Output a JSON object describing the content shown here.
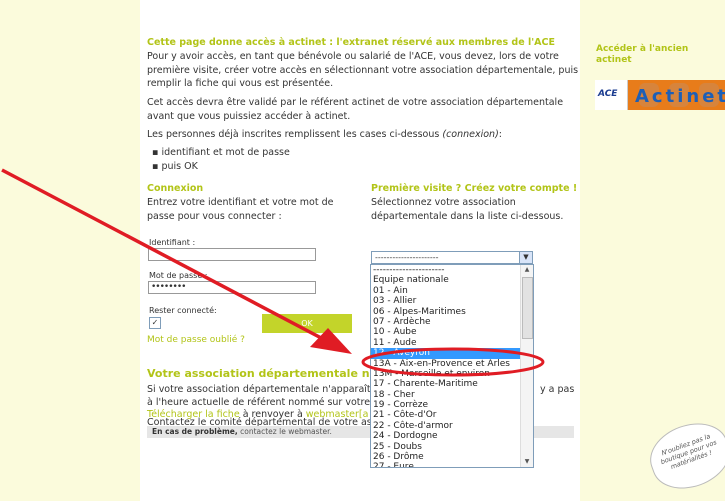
{
  "intro": {
    "heading": "Cette page donne accès à actinet : l'extranet réservé aux membres de l'ACE",
    "p1_line1": "Pour y avoir accès, en tant que bénévole ou salarié de l'ACE, vous devez, lors de votre",
    "p1_line2": "première visite, créer votre accès en sélectionnant votre association départementale, puis",
    "p1_line3": "remplir la fiche qui vous est présentée.",
    "p2_line1": "Cet accès devra être validé par le référent actinet de votre association départementale",
    "p2_line2": "avant que vous puissiez accéder à actinet.",
    "p3_prefix": "Les personnes déjà inscrites remplissent les cases ci-dessous ",
    "p3_italic": "(connexion)",
    "p3_suffix": ":",
    "bullet1": "identifiant et mot de passe",
    "bullet2": "puis OK"
  },
  "login": {
    "heading": "Connexion",
    "desc_line1": "Entrez votre identifiant et votre mot de",
    "desc_line2": "passe pour vous connecter :",
    "username_label": "Identifiant :",
    "username_value": "",
    "password_label": "Mot de passe :",
    "password_value": "••••••••",
    "remember_label": "Rester connecté:",
    "ok_label": "OK",
    "forgot_link": "Mot de passe oublié ?"
  },
  "first_visit": {
    "heading": "Première visite ? Créez votre compte !",
    "desc_line1": "Sélectionnez votre association",
    "desc_line2": "départementale dans la liste ci-dessous.",
    "select_value": "----------------------",
    "options": [
      "----------------------",
      "Equipe nationale",
      "01 - Ain",
      "03 - Allier",
      "06 - Alpes-Maritimes",
      "07 - Ardèche",
      "10 - Aube",
      "11 - Aude",
      "12 - Aveyron",
      "13A - Aix-en-Provence et Arles",
      "13M - Marseille et environ",
      "17 - Charente-Maritime",
      "18 - Cher",
      "19 - Corrèze",
      "21 - Côte-d'Or",
      "22 - Côte-d'armor",
      "24 - Dordogne",
      "25 - Doubs",
      "26 - Drôme",
      "27 - Eure"
    ],
    "selected_index": 8
  },
  "assoc": {
    "heading": "Votre association départementale n",
    "line1_left": "Si votre association départementale n'apparaît",
    "line1_right": "y a pas",
    "line2": "à l'heure actuelle de référent nommé sur votre",
    "line3": "Contactez le comité départemental de votre as",
    "download_link": "Télécharger la fiche",
    "send_text": " à renvoyer à ",
    "webmaster_link": "webmaster[a",
    "problem_bold": "En cas de problème,",
    "problem_link": " contactez le webmaster."
  },
  "sidebar": {
    "old_actinet_line1": "Accéder à l'ancien",
    "old_actinet_line2": "actinet",
    "banner_logo": "ACE",
    "banner_text": "Actinet",
    "sticker_text": "N'oubliez pas la boutique pour vos matérialités !"
  },
  "colors": {
    "accent": "#b2c418",
    "annotation": "#e01c24",
    "selection": "#3399ff",
    "page_bg": "#fbfbdc"
  }
}
